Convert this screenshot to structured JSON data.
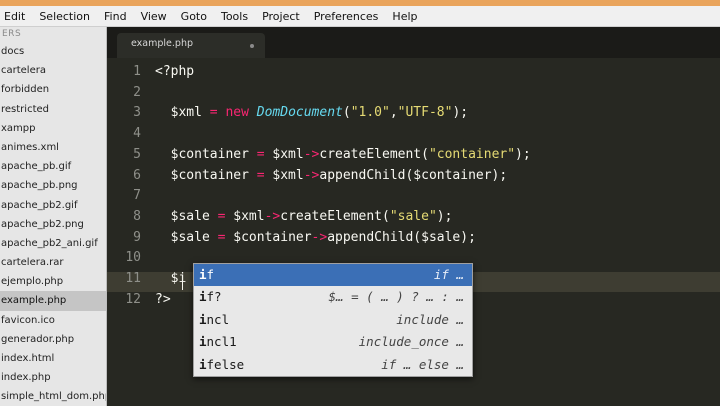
{
  "menubar": [
    "Edit",
    "Selection",
    "Find",
    "View",
    "Goto",
    "Tools",
    "Project",
    "Preferences",
    "Help"
  ],
  "sidebar": {
    "header": "ERS",
    "items": [
      {
        "label": "docs"
      },
      {
        "label": "cartelera"
      },
      {
        "label": "forbidden"
      },
      {
        "label": "restricted"
      },
      {
        "label": "xampp"
      },
      {
        "label": "animes.xml"
      },
      {
        "label": "apache_pb.gif"
      },
      {
        "label": "apache_pb.png"
      },
      {
        "label": "apache_pb2.gif"
      },
      {
        "label": "apache_pb2.png"
      },
      {
        "label": "apache_pb2_ani.gif"
      },
      {
        "label": "cartelera.rar"
      },
      {
        "label": "ejemplo.php"
      },
      {
        "label": "example.php",
        "active": true
      },
      {
        "label": "favicon.ico"
      },
      {
        "label": "generador.php"
      },
      {
        "label": "index.html"
      },
      {
        "label": "index.php"
      },
      {
        "label": "simple_html_dom.php"
      }
    ]
  },
  "tab": {
    "title": "example.php"
  },
  "line_numbers": [
    "1",
    "2",
    "3",
    "4",
    "5",
    "6",
    "7",
    "8",
    "9",
    "10",
    "11",
    "12"
  ],
  "code": [
    [
      {
        "t": "<?php",
        "c": ""
      }
    ],
    [],
    [
      {
        "t": "  $xml ",
        "c": ""
      },
      {
        "t": "=",
        "c": "op"
      },
      {
        "t": " ",
        "c": ""
      },
      {
        "t": "new",
        "c": "kw"
      },
      {
        "t": " ",
        "c": ""
      },
      {
        "t": "DomDocument",
        "c": "cls"
      },
      {
        "t": "(",
        "c": ""
      },
      {
        "t": "\"1.0\"",
        "c": "str"
      },
      {
        "t": ",",
        "c": ""
      },
      {
        "t": "\"UTF-8\"",
        "c": "str"
      },
      {
        "t": ");",
        "c": ""
      }
    ],
    [],
    [
      {
        "t": "  $container ",
        "c": ""
      },
      {
        "t": "=",
        "c": "op"
      },
      {
        "t": " $xml",
        "c": ""
      },
      {
        "t": "->",
        "c": "op"
      },
      {
        "t": "createElement(",
        "c": ""
      },
      {
        "t": "\"container\"",
        "c": "str"
      },
      {
        "t": ");",
        "c": ""
      }
    ],
    [
      {
        "t": "  $container ",
        "c": ""
      },
      {
        "t": "=",
        "c": "op"
      },
      {
        "t": " $xml",
        "c": ""
      },
      {
        "t": "->",
        "c": "op"
      },
      {
        "t": "appendChild($container);",
        "c": ""
      }
    ],
    [],
    [
      {
        "t": "  $sale ",
        "c": ""
      },
      {
        "t": "=",
        "c": "op"
      },
      {
        "t": " $xml",
        "c": ""
      },
      {
        "t": "->",
        "c": "op"
      },
      {
        "t": "createElement(",
        "c": ""
      },
      {
        "t": "\"sale\"",
        "c": "str"
      },
      {
        "t": ");",
        "c": ""
      }
    ],
    [
      {
        "t": "  $sale ",
        "c": ""
      },
      {
        "t": "=",
        "c": "op"
      },
      {
        "t": " $container",
        "c": ""
      },
      {
        "t": "->",
        "c": "op"
      },
      {
        "t": "appendChild($sale);",
        "c": ""
      }
    ],
    [],
    [
      {
        "t": "  $i",
        "c": ""
      }
    ],
    [
      {
        "t": "?>",
        "c": ""
      }
    ]
  ],
  "autocomplete": [
    {
      "match": "i",
      "rest": "f",
      "hint": "if …",
      "selected": true
    },
    {
      "match": "i",
      "rest": "f?",
      "hint": "$… = ( … ) ? … : …",
      "selected": false
    },
    {
      "match": "i",
      "rest": "ncl",
      "hint": "include …",
      "selected": false
    },
    {
      "match": "i",
      "rest": "ncl1",
      "hint": "include_once …",
      "selected": false
    },
    {
      "match": "i",
      "rest": "felse",
      "hint": "if … else …",
      "selected": false
    }
  ]
}
